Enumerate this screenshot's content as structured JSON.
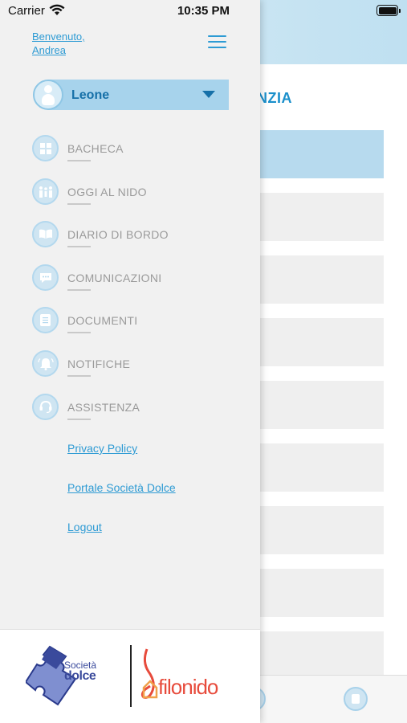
{
  "status_bar": {
    "carrier": "Carrier",
    "time": "10:35 PM"
  },
  "background": {
    "section_title_partial": "NZIA"
  },
  "drawer": {
    "welcome_line1": "Benvenuto,",
    "welcome_line2": "Andrea",
    "child_selector": {
      "selected": "Leone"
    },
    "menu": [
      {
        "label": "BACHECA",
        "icon": "grid-icon"
      },
      {
        "label": "OGGI AL NIDO",
        "icon": "family-icon"
      },
      {
        "label": "DIARIO DI BORDO",
        "icon": "book-icon"
      },
      {
        "label": "COMUNICAZIONI",
        "icon": "chat-bubble-icon"
      },
      {
        "label": "DOCUMENTI",
        "icon": "document-icon"
      },
      {
        "label": "NOTIFICHE",
        "icon": "bell-icon"
      },
      {
        "label": "ASSISTENZA",
        "icon": "headset-icon"
      }
    ],
    "links": {
      "privacy": "Privacy Policy",
      "portal": "Portale Società Dolce",
      "logout": "Logout"
    },
    "footer": {
      "logo1_line1": "Società",
      "logo1_line2": "dolce",
      "logo2": "filonido"
    }
  },
  "colors": {
    "accent": "#2e9bd4",
    "selector_bg": "#a7d3ec",
    "drawer_bg": "#f1f1f1",
    "logo_red": "#e74b3c",
    "logo_blue": "#3a4a9c"
  }
}
